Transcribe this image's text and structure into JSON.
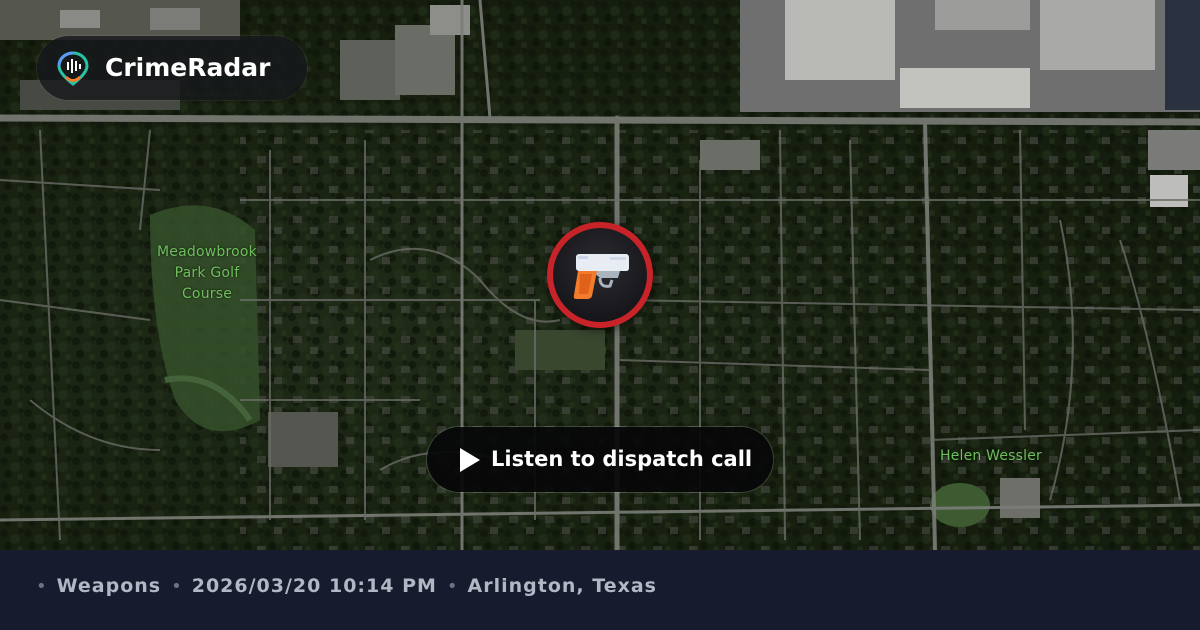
{
  "brand": {
    "name": "CrimeRadar",
    "icon": "radar-pin-icon",
    "accent_colors": [
      "#28c3a6",
      "#f47d2a",
      "#5a9bf4"
    ]
  },
  "map": {
    "labels": {
      "park": "Meadowbrook Park Golf Course",
      "park_lines": [
        "Meadowbrook",
        "Park Golf",
        "Course"
      ],
      "helen": "Helen Wessler"
    }
  },
  "incident": {
    "category_icon": "pistol-icon",
    "marker_ring_color": "#c9232a"
  },
  "listen_button": {
    "icon": "play-icon",
    "label": "Listen to dispatch call"
  },
  "info": {
    "separator": "•",
    "category": "Weapons",
    "datetime": "2026/03/20 10:14 PM",
    "location": "Arlington, Texas"
  }
}
